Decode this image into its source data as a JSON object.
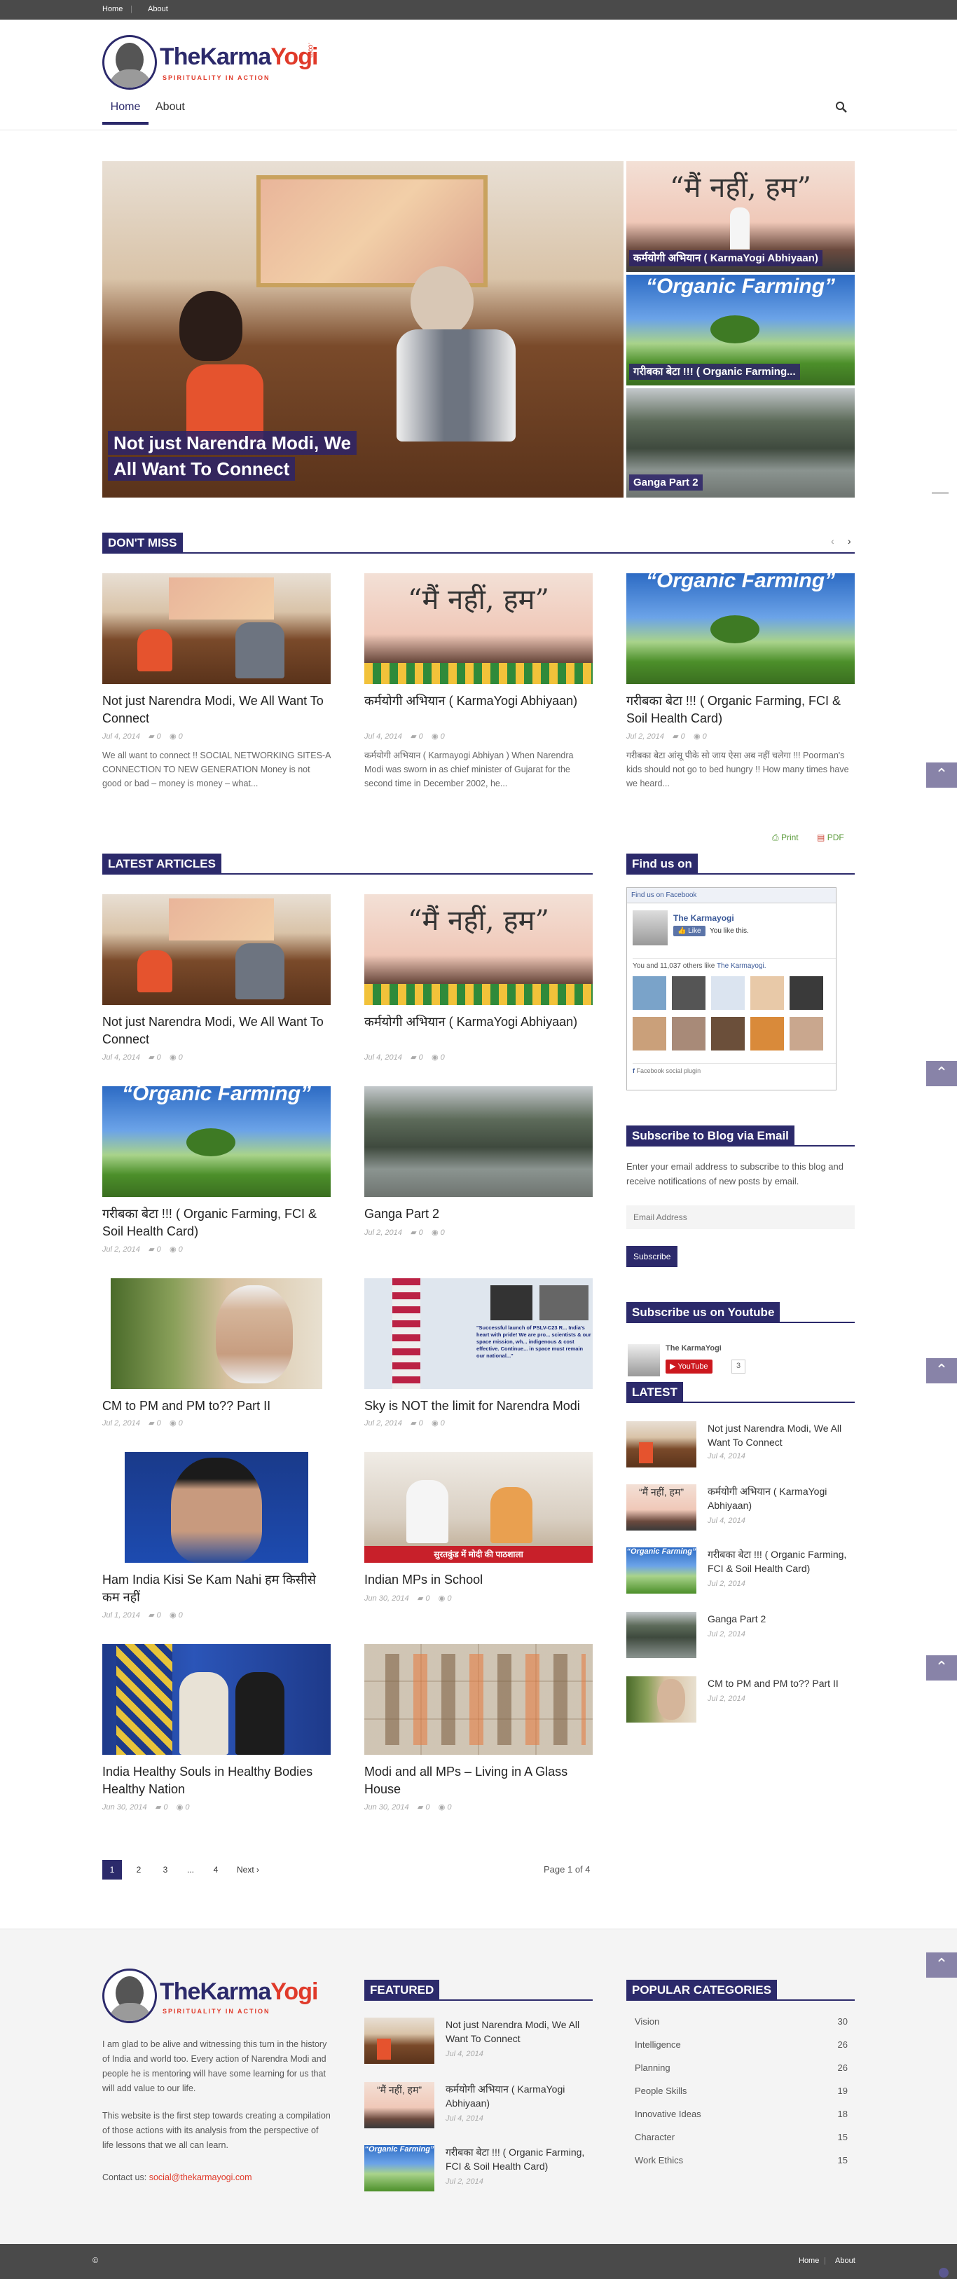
{
  "topbar": {
    "home": "Home",
    "about": "About"
  },
  "site": {
    "logo_text_main": "TheKarma",
    "logo_text_accent": "Yogi",
    "logo_suffix": ".com",
    "tagline": "SPIRITUALITY IN ACTION"
  },
  "nav": {
    "home": "Home",
    "about": "About"
  },
  "hero": {
    "main_title": "Not just Narendra Modi, We All Want To Connect",
    "side": [
      "कर्मयोगी अभियान ( KarmaYogi Abhiyaan)",
      "गरीबका बेटा !!! ( Organic Farming...",
      "Ganga Part 2"
    ],
    "banner_text_1": "“मैं नहीं, हम”",
    "banner_text_2": "“Organic Farming”"
  },
  "dont_miss": {
    "heading": "DON'T MISS",
    "items": [
      {
        "title": "Not just Narendra Modi, We All Want To Connect",
        "date": "Jul 4, 2014",
        "comments": "0",
        "views": "0",
        "excerpt": "We all want to connect !! SOCIAL NETWORKING SITES-A CONNECTION TO NEW GENERATION Money is not good or bad – money is money – what..."
      },
      {
        "title": "कर्मयोगी अभियान ( KarmaYogi Abhiyaan)",
        "date": "Jul 4, 2014",
        "comments": "0",
        "views": "0",
        "excerpt": "कर्मयोगी अभियान ( Karmayogi Abhiyan ) When Narendra Modi was sworn in as chief minister of Gujarat for the second time in December 2002, he..."
      },
      {
        "title": "गरीबका बेटा !!! ( Organic Farming, FCI & Soil Health Card)",
        "date": "Jul 2, 2014",
        "comments": "0",
        "views": "0",
        "excerpt": "गरीबका बेटा आंसू पीके सो जाय ऐसा अब नहीं चलेगा !!! Poorman's kids should not go to bed hungry !! How many times have we heard..."
      }
    ]
  },
  "print_links": {
    "print": "Print",
    "pdf": "PDF"
  },
  "latest": {
    "heading": "LATEST ARTICLES",
    "items": [
      {
        "title": "Not just Narendra Modi, We All Want To Connect",
        "date": "Jul 4, 2014",
        "comments": "0",
        "views": "0"
      },
      {
        "title": "कर्मयोगी अभियान ( KarmaYogi Abhiyaan)",
        "date": "Jul 4, 2014",
        "comments": "0",
        "views": "0"
      },
      {
        "title": "गरीबका बेटा !!! ( Organic Farming, FCI & Soil Health Card)",
        "date": "Jul 2, 2014",
        "comments": "0",
        "views": "0"
      },
      {
        "title": "Ganga Part 2",
        "date": "Jul 2, 2014",
        "comments": "0",
        "views": "0"
      },
      {
        "title": "CM to PM and PM to?? Part II",
        "date": "Jul 2, 2014",
        "comments": "0",
        "views": "0"
      },
      {
        "title": "Sky is NOT the limit for Narendra Modi",
        "date": "Jul 2, 2014",
        "comments": "0",
        "views": "0"
      },
      {
        "title": "Ham India Kisi Se Kam Nahi हम किसीसे कम नहीं",
        "date": "Jul 1, 2014",
        "comments": "0",
        "views": "0"
      },
      {
        "title": "Indian MPs in School",
        "date": "Jun 30, 2014",
        "comments": "0",
        "views": "0"
      },
      {
        "title": "India Healthy Souls in Healthy Bodies Healthy Nation",
        "date": "Jun 30, 2014",
        "comments": "0",
        "views": "0"
      },
      {
        "title": "Modi and all MPs – Living in A Glass House",
        "date": "Jun 30, 2014",
        "comments": "0",
        "views": "0"
      }
    ],
    "pslv_caption": "\"Successful launch of PSLV-C23 R... India's heart with pride! We are pro... scientists & our space mission, wh... indigenous & cost effective. Continue... in space must remain our national...\"",
    "news_caption": "सुरतकुंड में मोदी की पाठशाला"
  },
  "pagination": {
    "pages": [
      "1",
      "2",
      "3",
      "...",
      "4"
    ],
    "next": "Next",
    "page_info": "Page 1 of 4"
  },
  "sidebar": {
    "find_us": "Find us on",
    "fb": {
      "header": "Find us on Facebook",
      "page_name": "The Karmayogi",
      "like": "Like",
      "you_like": "You like this.",
      "others": "You and 11,037 others like",
      "others_link": "The Karmayogi.",
      "plugin": "Facebook social plugin"
    },
    "subscribe_heading": "Subscribe to Blog via Email",
    "subscribe_text": "Enter your email address to subscribe to this blog and receive notifications of new posts by email.",
    "email_placeholder": "Email Address",
    "subscribe_btn": "Subscribe",
    "youtube_heading": "Subscribe us on Youtube",
    "yt_channel": "The KarmaYogi",
    "yt_btn": "YouTube",
    "yt_count": "3",
    "latest_heading": "LATEST",
    "latest_items": [
      {
        "title": "Not just Narendra Modi, We All Want To Connect",
        "date": "Jul 4, 2014"
      },
      {
        "title": "कर्मयोगी अभियान ( KarmaYogi Abhiyaan)",
        "date": "Jul 4, 2014"
      },
      {
        "title": "गरीबका बेटा !!! ( Organic Farming, FCI & Soil Health Card)",
        "date": "Jul 2, 2014"
      },
      {
        "title": "Ganga Part 2",
        "date": "Jul 2, 2014"
      },
      {
        "title": "CM to PM and PM to?? Part II",
        "date": "Jul 2, 2014"
      }
    ]
  },
  "footer": {
    "about_1": "I am glad to be alive and witnessing this turn in the history of India and world too. Every action of Narendra Modi and people he is mentoring will have some learning for us that will add value to our life.",
    "about_2": "This website is the first step towards creating a compilation of those actions with its analysis from the perspective of life lessons that we all can learn.",
    "contact_label": "Contact us:",
    "contact_email": "social@thekarmayogi.com",
    "featured_heading": "FEATURED",
    "featured": [
      {
        "title": "Not just Narendra Modi, We All Want To Connect",
        "date": "Jul 4, 2014"
      },
      {
        "title": "कर्मयोगी अभियान ( KarmaYogi Abhiyaan)",
        "date": "Jul 4, 2014"
      },
      {
        "title": "गरीबका बेटा !!! ( Organic Farming, FCI & Soil Health Card)",
        "date": "Jul 2, 2014"
      }
    ],
    "categories_heading": "POPULAR CATEGORIES",
    "categories": [
      {
        "name": "Vision",
        "count": "30"
      },
      {
        "name": "Intelligence",
        "count": "26"
      },
      {
        "name": "Planning",
        "count": "26"
      },
      {
        "name": "People Skills",
        "count": "19"
      },
      {
        "name": "Innovative Ideas",
        "count": "18"
      },
      {
        "name": "Character",
        "count": "15"
      },
      {
        "name": "Work Ethics",
        "count": "15"
      }
    ]
  },
  "bottombar": {
    "copyright": "©",
    "home": "Home",
    "about": "About"
  },
  "icons": {
    "search": "search-icon",
    "scroll_up": "chevron-up-icon",
    "comment": "comment-icon",
    "eye": "eye-icon"
  }
}
